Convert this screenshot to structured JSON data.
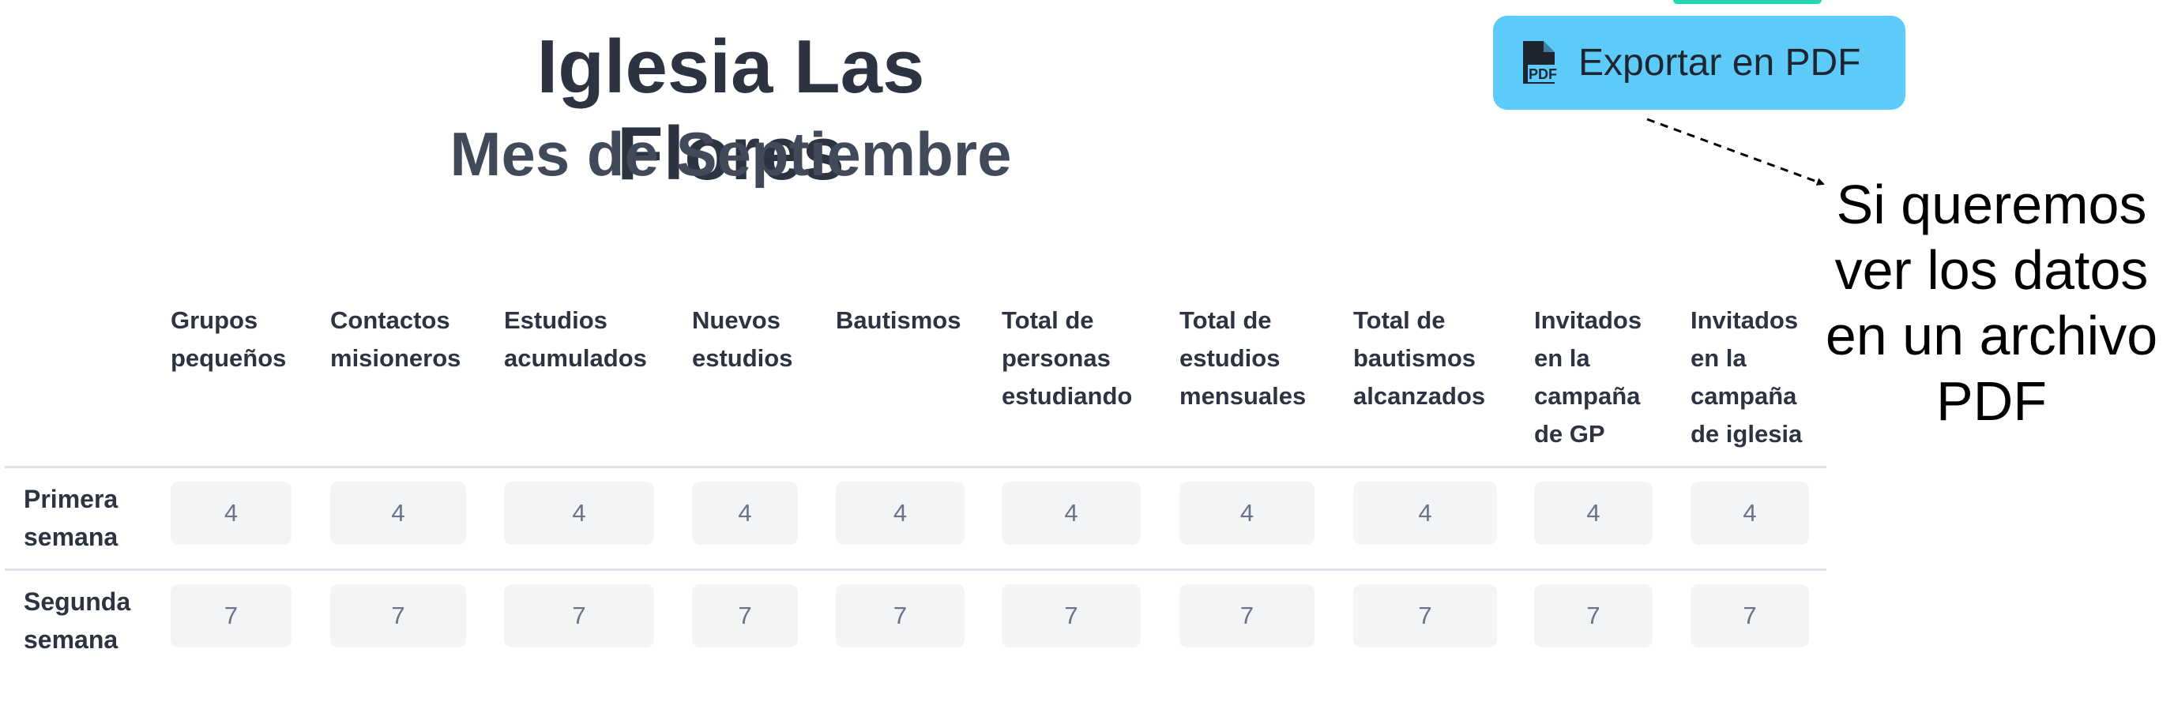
{
  "colors": {
    "export_button_bg": "#5ccbf9",
    "top_strip": "#1dd8b0",
    "cell_bg": "#f3f4f6",
    "cell_text": "#6b7387",
    "heading_text": "#2d3340"
  },
  "header": {
    "title": "Iglesia Las Flores",
    "subtitle": "Mes de Septiembre"
  },
  "toolbar": {
    "export_label": "Exportar en PDF",
    "export_icon": "pdf-file-icon",
    "export_icon_text": "PDF"
  },
  "annotation": {
    "text": "Si queremos\nver los datos\nen un archivo\nPDF"
  },
  "table": {
    "columns": [
      "Grupos\npequeños",
      "Contactos\nmisioneros",
      "Estudios\nacumulados",
      "Nuevos\nestudios",
      "Bautismos",
      "Total de\npersonas\nestudiando",
      "Total de\nestudios\nmensuales",
      "Total de\nbautismos\nalcanzados",
      "Invitados\nen la\ncampaña\nde GP",
      "Invitados\nen la\ncampaña\nde iglesia"
    ],
    "rows": [
      {
        "label": "Primera\nsemana",
        "values": [
          "4",
          "4",
          "4",
          "4",
          "4",
          "4",
          "4",
          "4",
          "4",
          "4"
        ]
      },
      {
        "label": "Segunda\nsemana",
        "values": [
          "7",
          "7",
          "7",
          "7",
          "7",
          "7",
          "7",
          "7",
          "7",
          "7"
        ]
      }
    ]
  }
}
